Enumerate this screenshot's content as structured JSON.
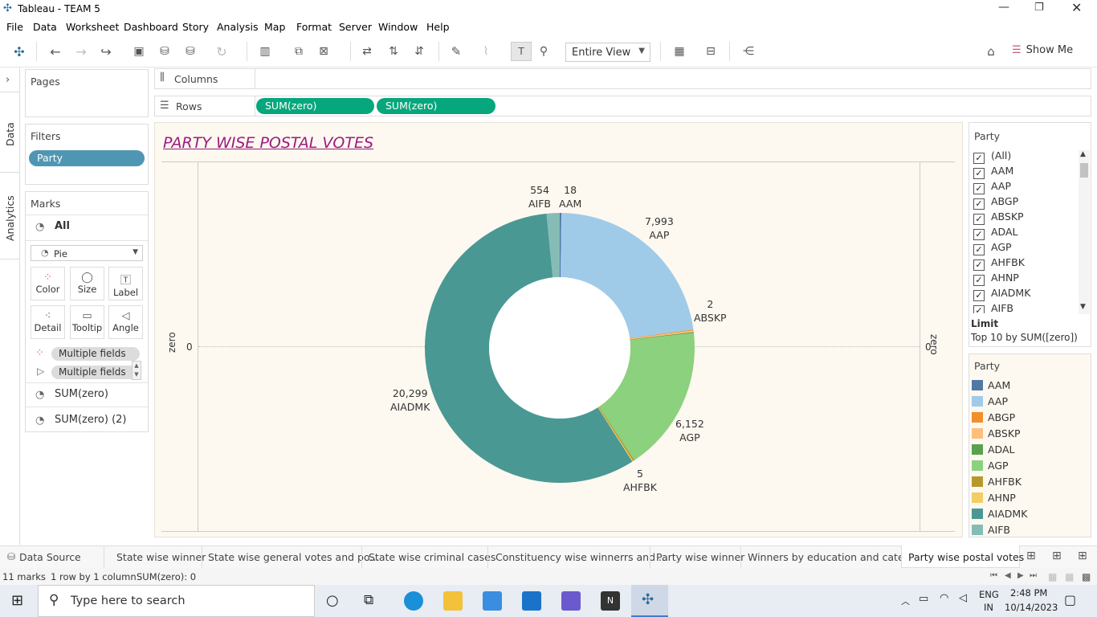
{
  "window": {
    "title": "Tableau - TEAM 5"
  },
  "menu": [
    "File",
    "Data",
    "Worksheet",
    "Dashboard",
    "Story",
    "Analysis",
    "Map",
    "Format",
    "Server",
    "Window",
    "Help"
  ],
  "toolbar": {
    "view_select": "Entire View",
    "show_me": "Show Me"
  },
  "side_tabs": {
    "data": "Data",
    "analytics": "Analytics"
  },
  "pages": {
    "title": "Pages"
  },
  "filters": {
    "title": "Filters",
    "pill": "Party"
  },
  "marks": {
    "title": "Marks",
    "all": "All",
    "type": "Pie",
    "buttons": {
      "color": "Color",
      "size": "Size",
      "label": "Label",
      "detail": "Detail",
      "tooltip": "Tooltip",
      "angle": "Angle"
    },
    "fields": [
      "Multiple fields",
      "Multiple fields"
    ],
    "sections": [
      "SUM(zero)",
      "SUM(zero) (2)"
    ]
  },
  "shelves": {
    "columns": "Columns",
    "rows": "Rows",
    "row_pills": [
      "SUM(zero)",
      "SUM(zero)"
    ]
  },
  "chart_data": {
    "type": "pie",
    "title": "PARTY WISE POSTAL VOTES",
    "axis_label": "zero",
    "axis_tick": "0",
    "slices": [
      {
        "label": "AAM",
        "value": 18,
        "color": "#4e79a7"
      },
      {
        "label": "AAP",
        "value": 7993,
        "color": "#a0cbe8"
      },
      {
        "label": "ABGP",
        "value": 0,
        "color": "#f28e2b"
      },
      {
        "label": "ABSKP",
        "value": 2,
        "color": "#ffbe7d"
      },
      {
        "label": "ADAL",
        "value": 0,
        "color": "#59a14f"
      },
      {
        "label": "AGP",
        "value": 6152,
        "color": "#8cd17d"
      },
      {
        "label": "AHFBK",
        "value": 5,
        "color": "#b6992d"
      },
      {
        "label": "AHNP",
        "value": 0,
        "color": "#f1ce63"
      },
      {
        "label": "AIADMK",
        "value": 20299,
        "color": "#499894"
      },
      {
        "label": "AIFB",
        "value": 554,
        "color": "#86bcb6"
      }
    ],
    "labels": [
      {
        "value": "554",
        "name": "AIFB"
      },
      {
        "value": "18",
        "name": "AAM"
      },
      {
        "value": "7,993",
        "name": "AAP"
      },
      {
        "value": "2",
        "name": "ABSKP"
      },
      {
        "value": "6,152",
        "name": "AGP"
      },
      {
        "value": "5",
        "name": "AHFBK"
      },
      {
        "value": "20,299",
        "name": "AIADMK"
      }
    ]
  },
  "filter_card": {
    "title": "Party",
    "items": [
      "(All)",
      "AAM",
      "AAP",
      "ABGP",
      "ABSKP",
      "ADAL",
      "AGP",
      "AHFBK",
      "AHNP",
      "AIADMK",
      "AIFB"
    ],
    "limit_label": "Limit",
    "limit_value": "Top 10 by SUM([zero])"
  },
  "legend": {
    "title": "Party",
    "items": [
      {
        "name": "AAM",
        "color": "#4e79a7"
      },
      {
        "name": "AAP",
        "color": "#a0cbe8"
      },
      {
        "name": "ABGP",
        "color": "#f28e2b"
      },
      {
        "name": "ABSKP",
        "color": "#ffbe7d"
      },
      {
        "name": "ADAL",
        "color": "#59a14f"
      },
      {
        "name": "AGP",
        "color": "#8cd17d"
      },
      {
        "name": "AHFBK",
        "color": "#b6992d"
      },
      {
        "name": "AHNP",
        "color": "#f1ce63"
      },
      {
        "name": "AIADMK",
        "color": "#499894"
      },
      {
        "name": "AIFB",
        "color": "#86bcb6"
      }
    ]
  },
  "sheet_tabs": [
    "Data Source",
    "State wise winner",
    "State wise general votes and po...",
    "State wise criminal cases",
    "Constituency wise winnerrs and ...",
    "Party wise winner",
    "Winners by education and categ...",
    "Party wise postal votes"
  ],
  "status": {
    "marks": "11 marks",
    "dims": "1 row by 1 column",
    "sum": "SUM(zero): 0"
  },
  "taskbar": {
    "search_placeholder": "Type here to search",
    "lang1": "ENG",
    "lang2": "IN",
    "time": "2:48 PM",
    "date": "10/14/2023"
  }
}
